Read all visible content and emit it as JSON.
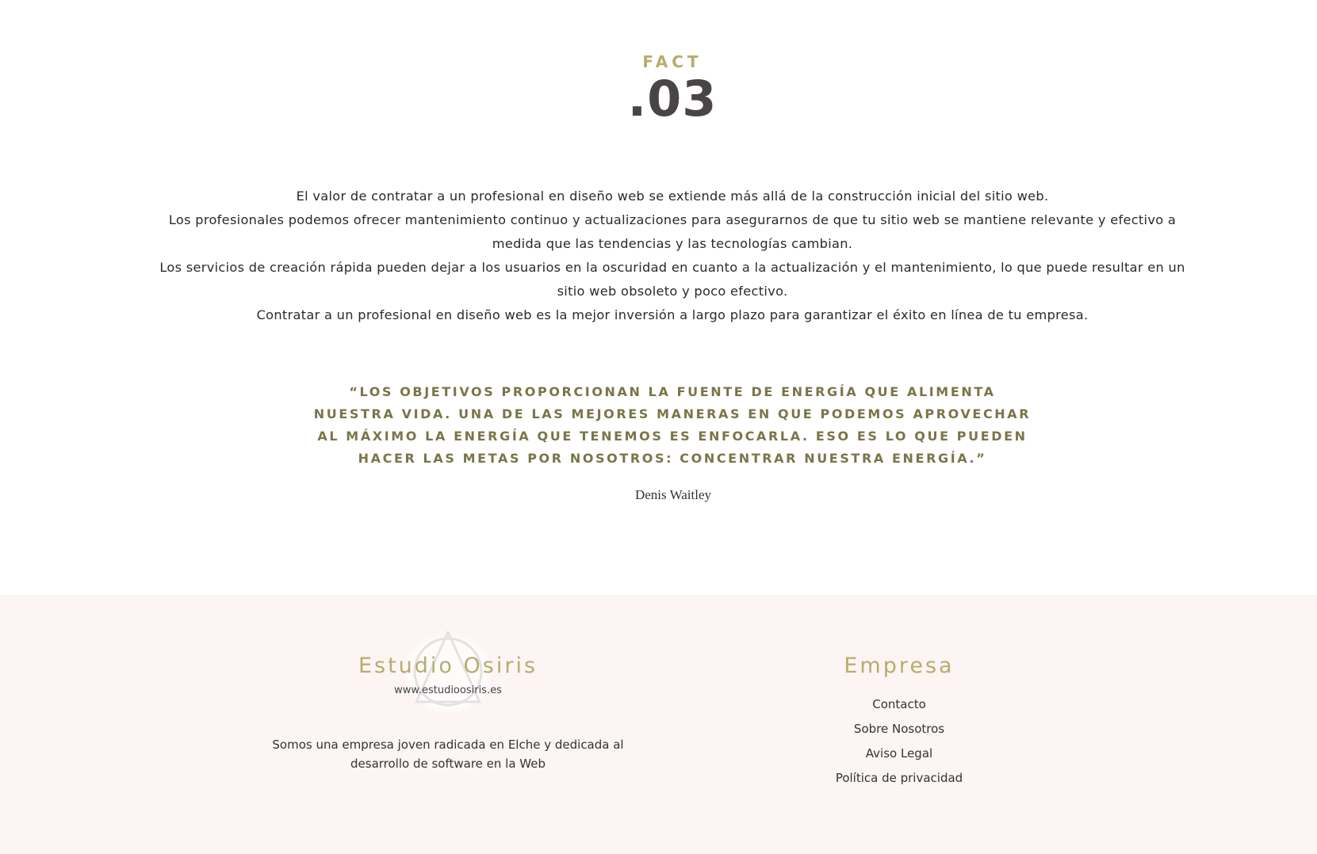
{
  "fact": {
    "label": "FACT",
    "number": ".03",
    "paragraphs": [
      "El valor de contratar a un profesional en diseño web se extiende más allá de la construcción inicial del sitio web.",
      "Los profesionales podemos ofrecer mantenimiento continuo y actualizaciones para asegurarnos de que tu sitio web se mantiene relevante y efectivo a medida que las tendencias y las tecnologías cambian.",
      "Los servicios de creación rápida pueden dejar a los usuarios en la oscuridad en cuanto a la actualización y el mantenimiento, lo que puede resultar en un sitio web obsoleto y poco efectivo.",
      "Contratar a un profesional en diseño web es la mejor inversión a largo plazo para garantizar el éxito en línea de tu empresa."
    ]
  },
  "quote": {
    "text": "“LOS OBJETIVOS PROPORCIONAN LA FUENTE DE ENERGÍA QUE ALIMENTA NUESTRA VIDA. UNA DE LAS MEJORES MANERAS EN QUE PODEMOS APROVECHAR AL MÁXIMO LA ENERGÍA QUE TENEMOS ES ENFOCARLA. ESO ES LO QUE PUEDEN HACER LAS METAS POR NOSOTROS: CONCENTRAR NUESTRA ENERGÍA.”",
    "author": "Denis Waitley"
  },
  "footer": {
    "brand": {
      "name": "Estudio Osiris",
      "url": "www.estudioosiris.es",
      "description": "Somos una empresa joven radicada en Elche y dedicada al desarrollo de software en la Web"
    },
    "company": {
      "title": "Empresa",
      "links": [
        "Contacto",
        "Sobre Nosotros",
        "Aviso Legal",
        "Política de privacidad"
      ]
    }
  },
  "colors": {
    "accent": "#b8ac6c",
    "quote": "#7a7548",
    "footer_bg": "#fdf4f4",
    "heading_dark": "#4a4545"
  }
}
